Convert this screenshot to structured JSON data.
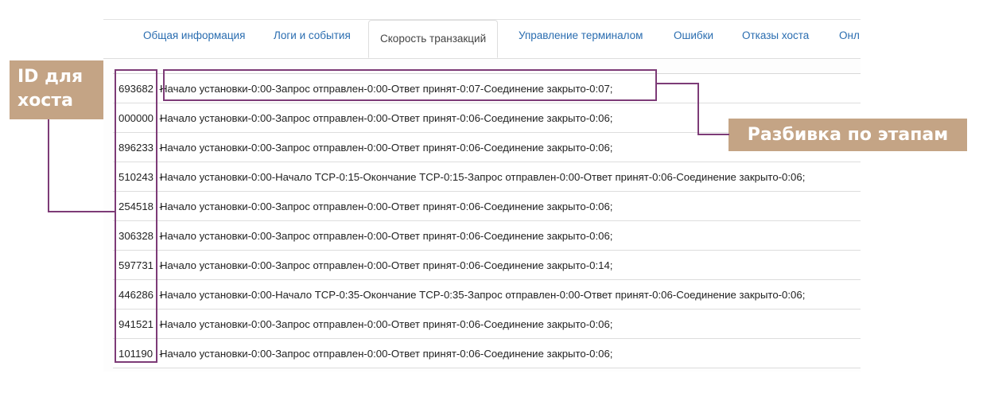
{
  "tabs": [
    {
      "label": "Общая информация",
      "active": false
    },
    {
      "label": "Логи и события",
      "active": false
    },
    {
      "label": "Скорость транзакций",
      "active": true
    },
    {
      "label": "Управление терминалом",
      "active": false
    },
    {
      "label": "Ошибки",
      "active": false
    },
    {
      "label": "Отказы хоста",
      "active": false
    },
    {
      "label": "Онл",
      "active": false
    }
  ],
  "rows": [
    {
      "host": "693682",
      "sep": "-",
      "text": "Начало установки-0:00-Запрос отправлен-0:00-Ответ принят-0:07-Соединение закрыто-0:07;"
    },
    {
      "host": "000000",
      "sep": "-",
      "text": "Начало установки-0:00-Запрос отправлен-0:00-Ответ принят-0:06-Соединение закрыто-0:06;"
    },
    {
      "host": "896233",
      "sep": "-",
      "text": "Начало установки-0:00-Запрос отправлен-0:00-Ответ принят-0:06-Соединение закрыто-0:06;"
    },
    {
      "host": "510243",
      "sep": "-",
      "text": "Начало установки-0:00-Начало TCP-0:15-Окончание TCP-0:15-Запрос отправлен-0:00-Ответ принят-0:06-Соединение закрыто-0:06;"
    },
    {
      "host": "254518",
      "sep": "-",
      "text": "Начало установки-0:00-Запрос отправлен-0:00-Ответ принят-0:06-Соединение закрыто-0:06;"
    },
    {
      "host": "306328",
      "sep": "-",
      "text": "Начало установки-0:00-Запрос отправлен-0:00-Ответ принят-0:06-Соединение закрыто-0:06;"
    },
    {
      "host": "597731",
      "sep": "-",
      "text": "Начало установки-0:00-Запрос отправлен-0:00-Ответ принят-0:06-Соединение закрыто-0:14;"
    },
    {
      "host": "446286",
      "sep": "-",
      "text": "Начало установки-0:00-Начало TCP-0:35-Окончание TCP-0:35-Запрос отправлен-0:00-Ответ принят-0:06-Соединение закрыто-0:06;"
    },
    {
      "host": "941521",
      "sep": "-",
      "text": "Начало установки-0:00-Запрос отправлен-0:00-Ответ принят-0:06-Соединение закрыто-0:06;"
    },
    {
      "host": "101190",
      "sep": "-",
      "text": "Начало установки-0:00-Запрос отправлен-0:00-Ответ принят-0:06-Соединение закрыто-0:06;"
    }
  ],
  "annotations": {
    "host_id_line1": "ID для",
    "host_id_line2": "хоста",
    "stages": "Разбивка по этапам"
  },
  "colors": {
    "callout_bg": "#c4a485",
    "callout_outline": "#7d3b77",
    "tab_link": "#2a6db0"
  }
}
